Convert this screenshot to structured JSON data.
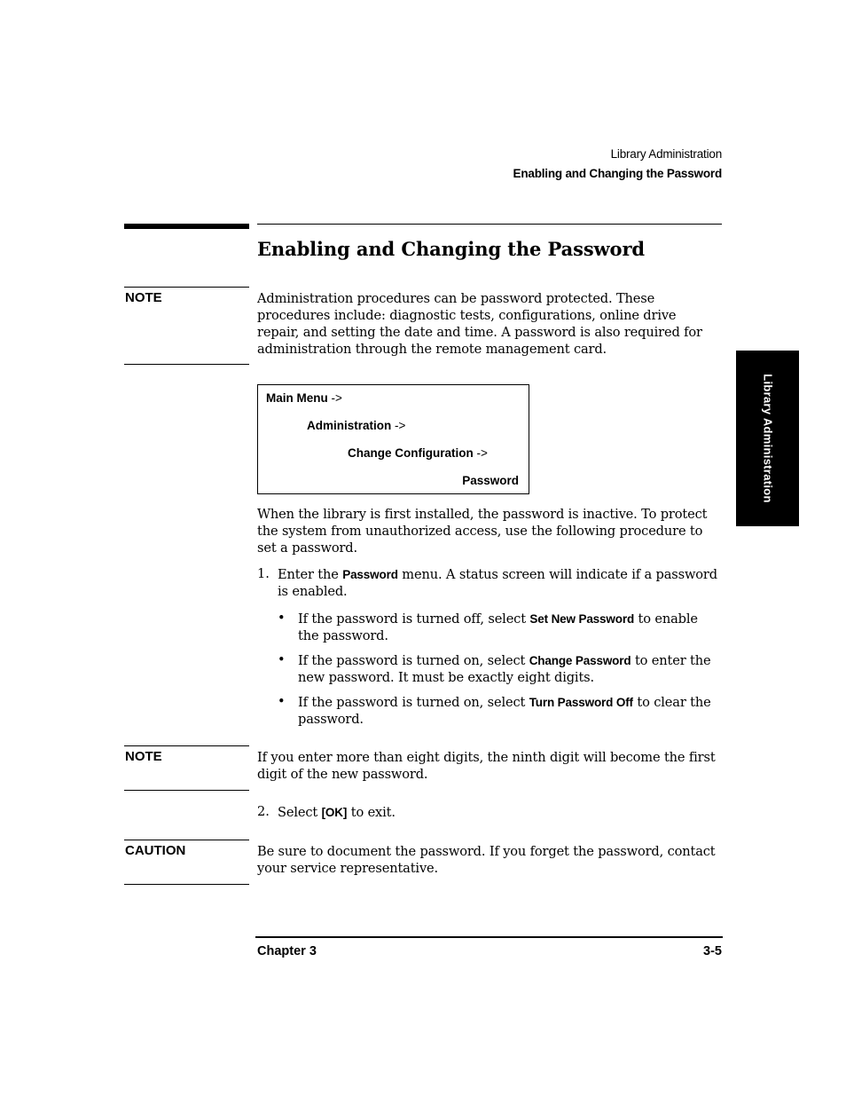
{
  "running_header": {
    "section": "Library Administration",
    "topic": "Enabling and Changing the Password"
  },
  "page_title": "Enabling and Changing the Password",
  "side_tab": "Library Administration",
  "note1": {
    "label": "NOTE",
    "text": "Administration procedures can be password protected. These procedures include: diagnostic tests, configurations, online drive repair, and setting the date and time. A password is also required for administration through the remote management card."
  },
  "menu_path": [
    {
      "label": "Main Menu",
      "arrow": " ->"
    },
    {
      "label": "Administration",
      "arrow": " ->"
    },
    {
      "label": "Change Configuration",
      "arrow": " ->"
    },
    {
      "label": "Password",
      "arrow": ""
    }
  ],
  "intro_paragraph": "When the library is first installed, the password is inactive. To protect the system from unauthorized access, use the following procedure to set a password.",
  "steps": [
    {
      "number": "1.",
      "before": "Enter the ",
      "term": "Password",
      "after": " menu. A status screen will indicate if a password is enabled."
    },
    {
      "number": "2.",
      "before": "Select ",
      "term": "[OK]",
      "after": " to exit."
    }
  ],
  "bullets": [
    {
      "symbol": "•",
      "before": "If the password is turned off, select ",
      "term": "Set New Password",
      "after": " to enable the password."
    },
    {
      "symbol": "•",
      "before": "If the password is turned on, select ",
      "term": "Change Password",
      "after": " to enter the new password. It must be exactly eight digits."
    },
    {
      "symbol": "•",
      "before": "If the password is turned on, select ",
      "term": "Turn Password Off",
      "after": " to clear the password."
    }
  ],
  "note2": {
    "label": "NOTE",
    "text": "If you enter more than eight digits, the ninth digit will become the first digit of the new password."
  },
  "caution": {
    "label": "CAUTION",
    "text": "Be sure to document the password. If you forget the password, contact your service representative."
  },
  "footer": {
    "chapter": "Chapter 3",
    "page": "3-5"
  }
}
